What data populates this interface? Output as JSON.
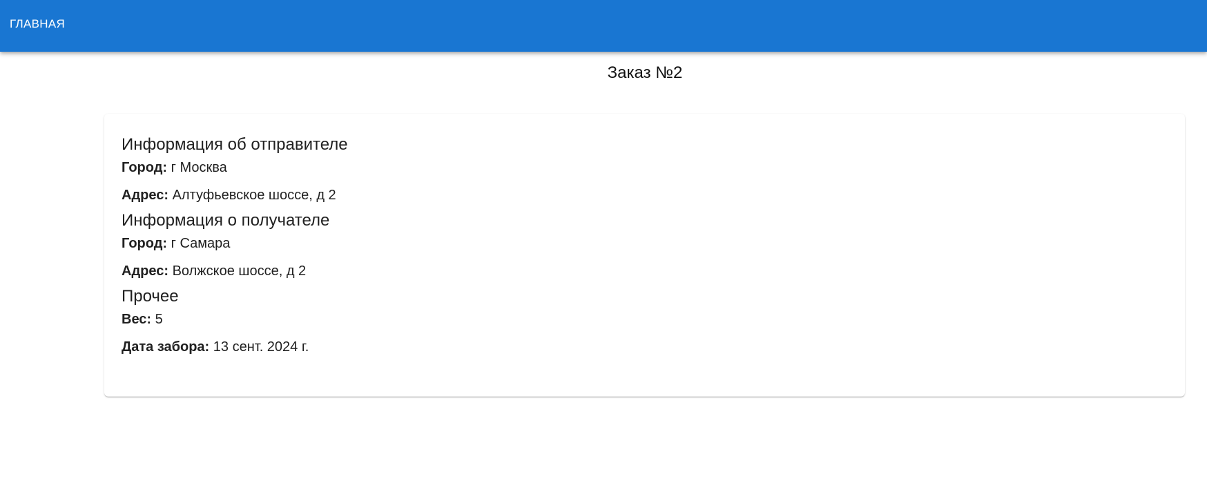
{
  "nav": {
    "home_label": "Главная"
  },
  "page": {
    "title": "Заказ №2"
  },
  "sender": {
    "title": "Информация об отправителе",
    "city_label": "Город:",
    "city_value": "г Москва",
    "address_label": "Адрес:",
    "address_value": "Алтуфьевское шоссе, д 2"
  },
  "recipient": {
    "title": "Информация о получателе",
    "city_label": "Город:",
    "city_value": "г Самара",
    "address_label": "Адрес:",
    "address_value": "Волжское шоссе, д 2"
  },
  "other": {
    "title": "Прочее",
    "weight_label": "Вес:",
    "weight_value": "5",
    "pickup_date_label": "Дата забора:",
    "pickup_date_value": "13 сент. 2024 г."
  },
  "colors": {
    "app_bar": "#1976d2",
    "text": "#212121"
  }
}
